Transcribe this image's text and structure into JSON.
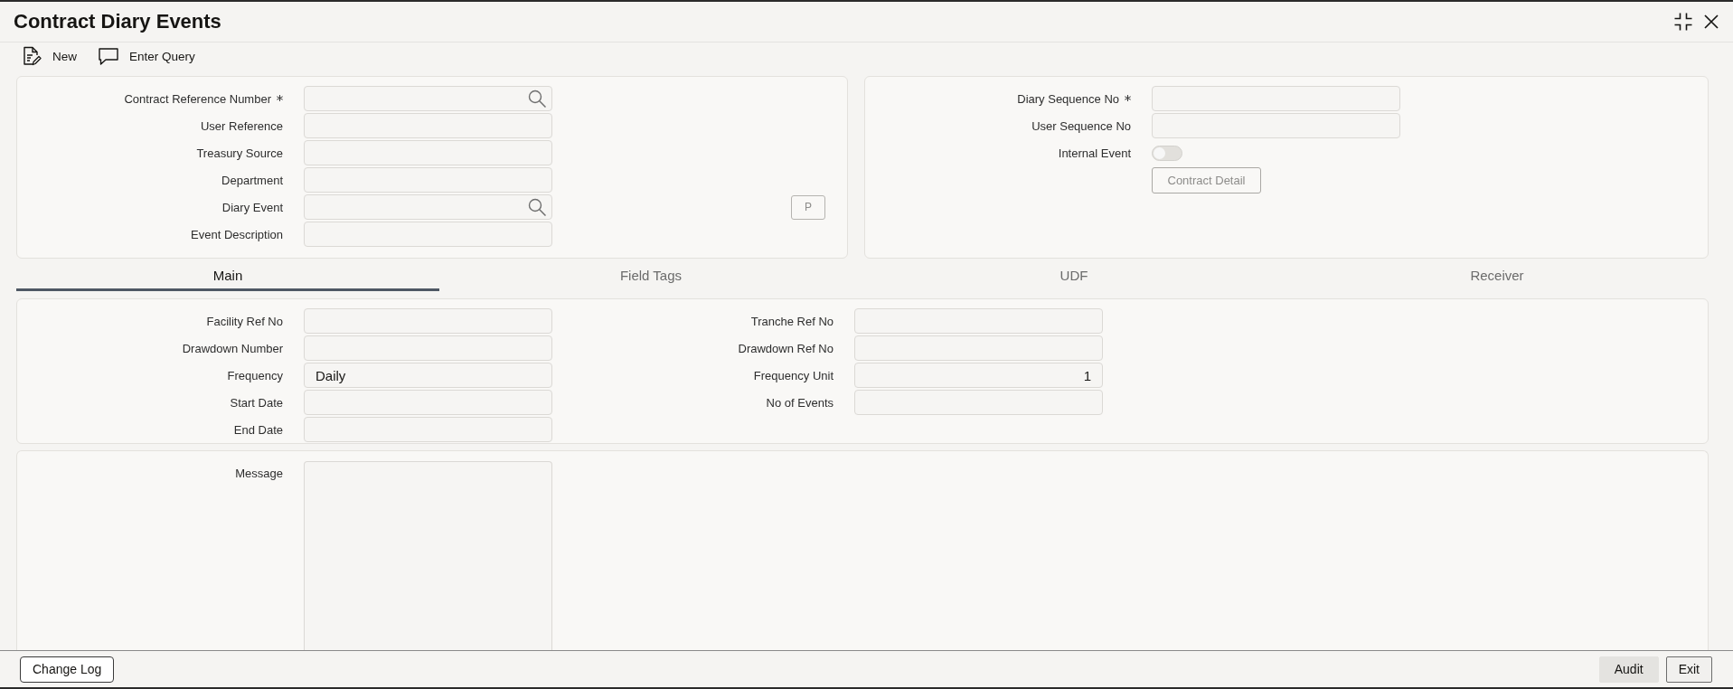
{
  "window": {
    "title": "Contract Diary Events"
  },
  "toolbar": [
    {
      "label": "New",
      "kind": "new"
    },
    {
      "label": "Enter Query",
      "kind": "query"
    }
  ],
  "header_left": {
    "fields": [
      {
        "label": "Contract Reference Number",
        "kind": "lookup",
        "required": true
      },
      {
        "label": "User Reference",
        "kind": "text",
        "required": false
      },
      {
        "label": "Treasury Source",
        "kind": "text",
        "required": false
      },
      {
        "label": "Department",
        "kind": "text",
        "required": false
      },
      {
        "label": "Diary Event",
        "kind": "lookup",
        "required": false
      },
      {
        "label": "Event Description",
        "kind": "text",
        "required": false
      }
    ],
    "side_button": {
      "label": "P",
      "disabled": true
    }
  },
  "header_right": {
    "fields": [
      {
        "label": "Diary Sequence No",
        "kind": "text",
        "required": true
      },
      {
        "label": "User Sequence No",
        "kind": "text",
        "required": false
      }
    ],
    "internal_event": {
      "label": "Internal Event",
      "on": false
    },
    "button": {
      "label": "Contract Detail",
      "disabled": true
    }
  },
  "tabs": [
    {
      "label": "Main",
      "selected": true
    },
    {
      "label": "Field Tags",
      "selected": false
    },
    {
      "label": "UDF",
      "selected": false
    },
    {
      "label": "Receiver",
      "selected": false
    }
  ],
  "main": {
    "left_fields": [
      {
        "label": "Facility Ref No",
        "kind": "text"
      },
      {
        "label": "Drawdown Number",
        "kind": "text"
      },
      {
        "label": "Frequency",
        "kind": "text",
        "value": "Daily"
      },
      {
        "label": "Start Date",
        "kind": "text"
      },
      {
        "label": "End Date",
        "kind": "text"
      }
    ],
    "right_fields": [
      {
        "label": "Tranche Ref No",
        "kind": "text"
      },
      {
        "label": "Drawdown Ref No",
        "kind": "text"
      },
      {
        "label": "Frequency Unit",
        "kind": "number",
        "value": "1"
      },
      {
        "label": "No of Events",
        "kind": "text"
      }
    ]
  },
  "message": {
    "label": "Message"
  },
  "footer": {
    "left_buttons": [
      {
        "label": "Change Log",
        "kind": "outlined"
      }
    ],
    "right_buttons": [
      {
        "label": "Audit",
        "kind": "flat"
      },
      {
        "label": "Exit",
        "kind": "secondary"
      }
    ]
  }
}
